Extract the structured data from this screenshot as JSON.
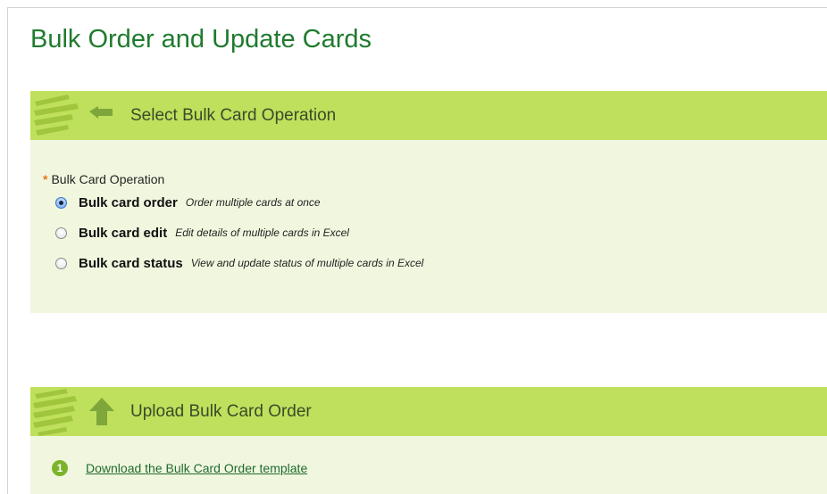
{
  "page": {
    "title": "Bulk Order and Update Cards"
  },
  "operation_section": {
    "title": "Select Bulk Card Operation",
    "required_marker": "*",
    "field_label": "Bulk Card Operation",
    "options": [
      {
        "label": "Bulk card order",
        "description": "Order multiple cards at once",
        "selected": true
      },
      {
        "label": "Bulk card edit",
        "description": "Edit details of multiple cards in Excel",
        "selected": false
      },
      {
        "label": "Bulk card status",
        "description": "View and update status of multiple cards in Excel",
        "selected": false
      }
    ]
  },
  "upload_section": {
    "title": "Upload Bulk Card Order",
    "steps": [
      {
        "number": "1",
        "link_text": "Download the Bulk Card Order template"
      }
    ]
  },
  "colors": {
    "title_green": "#1f7b2e",
    "header_band": "#bfe05c",
    "section_body": "#f1f7df",
    "required": "#e5791f",
    "step_badge": "#7cb32b"
  },
  "icons": [
    "lines-arrow-left-icon",
    "lines-arrow-up-icon",
    "radio-icon"
  ]
}
